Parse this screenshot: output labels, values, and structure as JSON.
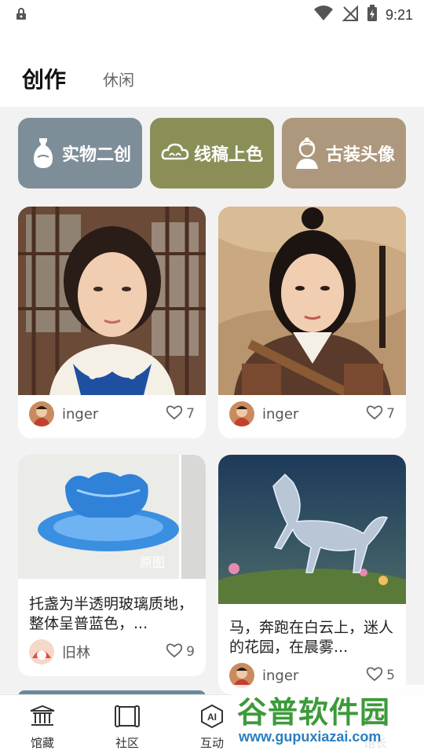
{
  "status_bar": {
    "time": "9:21"
  },
  "header": {
    "tab_active": "创作",
    "tab_inactive": "休闲"
  },
  "categories": [
    {
      "label": "实物二创",
      "icon": "vase-icon",
      "color": "#7d8e99"
    },
    {
      "label": "线稿上色",
      "icon": "cloud-sketch-icon",
      "color": "#8b8f57"
    },
    {
      "label": "古装头像",
      "icon": "portrait-icon",
      "color": "#ad987d"
    }
  ],
  "feed": [
    {
      "user": "inger",
      "likes": "7"
    },
    {
      "user": "inger",
      "likes": "7"
    },
    {
      "caption": "托盏为半透明玻璃质地，整体呈普蓝色，...",
      "user": "旧林",
      "likes": "9",
      "badge": "原图"
    },
    {
      "caption": "马，奔跑在白云上，迷人的花园，在晨雾...",
      "user": "inger",
      "likes": "5"
    }
  ],
  "nav": [
    {
      "label": "馆藏",
      "icon": "museum-icon"
    },
    {
      "label": "社区",
      "icon": "scroll-icon"
    },
    {
      "label": "互动",
      "icon": "ai-icon"
    },
    {
      "label": "馆长",
      "icon": "profile-icon"
    }
  ],
  "watermark": {
    "title": "谷普软件园",
    "url": "www.gupuxiazai.com"
  }
}
